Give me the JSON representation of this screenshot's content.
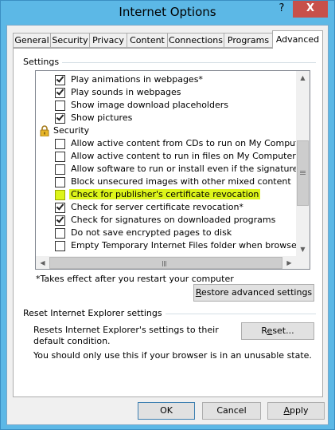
{
  "window": {
    "title": "Internet Options",
    "help_glyph": "?",
    "close_glyph": "X"
  },
  "tabs": [
    {
      "label": "General"
    },
    {
      "label": "Security"
    },
    {
      "label": "Privacy"
    },
    {
      "label": "Content"
    },
    {
      "label": "Connections"
    },
    {
      "label": "Programs"
    },
    {
      "label": "Advanced",
      "active": true
    }
  ],
  "settings": {
    "group_label": "Settings",
    "items": [
      {
        "label": "Play animations in webpages*",
        "type": "checkbox",
        "checked": true
      },
      {
        "label": "Play sounds in webpages",
        "type": "checkbox",
        "checked": true
      },
      {
        "label": "Show image download placeholders",
        "type": "checkbox",
        "checked": false
      },
      {
        "label": "Show pictures",
        "type": "checkbox",
        "checked": true
      },
      {
        "label": "Security",
        "type": "category",
        "icon": "lock-icon"
      },
      {
        "label": "Allow active content from CDs to run on My Computer*",
        "type": "checkbox",
        "checked": false
      },
      {
        "label": "Allow active content to run in files on My Computer*",
        "type": "checkbox",
        "checked": false
      },
      {
        "label": "Allow software to run or install even if the signature is inva",
        "type": "checkbox",
        "checked": false
      },
      {
        "label": "Block unsecured images with other mixed content",
        "type": "checkbox",
        "checked": false
      },
      {
        "label": "Check for publisher's certificate revocation",
        "type": "checkbox",
        "checked": false,
        "highlighted": true
      },
      {
        "label": "Check for server certificate revocation*",
        "type": "checkbox",
        "checked": true
      },
      {
        "label": "Check for signatures on downloaded programs",
        "type": "checkbox",
        "checked": true
      },
      {
        "label": "Do not save encrypted pages to disk",
        "type": "checkbox",
        "checked": false
      },
      {
        "label": "Empty Temporary Internet Files folder when browser is clo",
        "type": "checkbox",
        "checked": false
      }
    ],
    "note": "*Takes effect after you restart your computer",
    "restore_button": {
      "prefix": "",
      "accel": "R",
      "rest": "estore advanced settings"
    }
  },
  "reset": {
    "group_label": "Reset Internet Explorer settings",
    "description": "Resets Internet Explorer's settings to their default condition.",
    "warning": "You should only use this if your browser is in an unusable state.",
    "button": {
      "prefix": "R",
      "accel": "e",
      "rest": "set..."
    }
  },
  "footer": {
    "ok": "OK",
    "cancel": "Cancel",
    "apply": {
      "prefix": "",
      "accel": "A",
      "rest": "pply"
    }
  },
  "colors": {
    "title_bar": "#5cb8e6",
    "close": "#c7504a",
    "highlight": "#ddf51a"
  }
}
